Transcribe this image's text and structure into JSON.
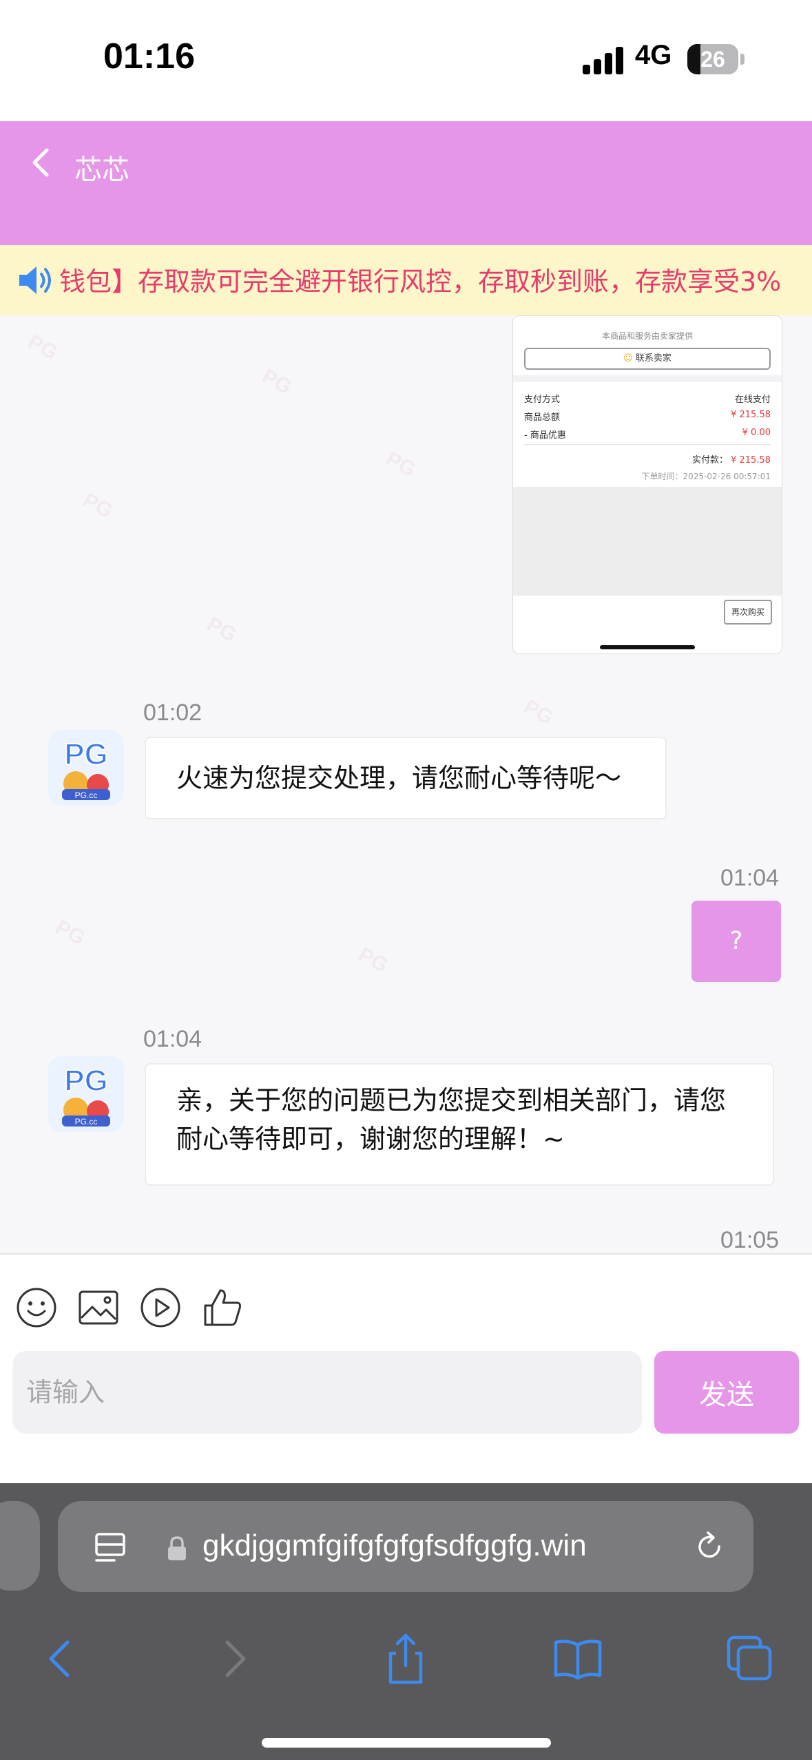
{
  "status_bar": {
    "time": "01:16",
    "network": "4G",
    "battery": "26"
  },
  "header": {
    "title": "芯芯"
  },
  "marquee": {
    "text": "钱包】存取款可完全避开银行风控，存取秒到账，存款享受3%"
  },
  "screenshot_card": {
    "note": "本商品和服务由卖家提供",
    "contact_seller": "联系卖家",
    "payment_method_label": "支付方式",
    "payment_method_value": "在线支付",
    "goods_total_label": "商品总额",
    "goods_total_value": "¥ 215.58",
    "discount_label": "- 商品优惠",
    "discount_value": "¥ 0.00",
    "paid_label": "实付款：",
    "paid_value": "¥ 215.58",
    "order_time": "下单时间：2025-02-26 00:57:01",
    "rebuy": "再次购买"
  },
  "messages": [
    {
      "from": "agent",
      "time": "01:02",
      "text": "火速为您提交处理，请您耐心等待呢～"
    },
    {
      "from": "user",
      "time": "01:04",
      "text": "?"
    },
    {
      "from": "agent",
      "time": "01:04",
      "text": "亲，关于您的问题已为您提交到相关部门，请您耐心等待即可，谢谢您的理解！~"
    },
    {
      "from": "user",
      "time": "01:05",
      "text": ""
    }
  ],
  "avatar": {
    "main": "PG",
    "sub": "PG.cc"
  },
  "input": {
    "placeholder": "请输入",
    "send_label": "发送"
  },
  "browser": {
    "url": "gkdjggmfgifgfgfgfsdfggfg.win"
  },
  "watermark": "PG",
  "colors": {
    "accent": "#e596e8",
    "marquee_bg": "#fdf6c9",
    "marquee_text": "#e83a6c",
    "browser_bg": "#59595b",
    "icon_blue": "#3d8bf0"
  }
}
